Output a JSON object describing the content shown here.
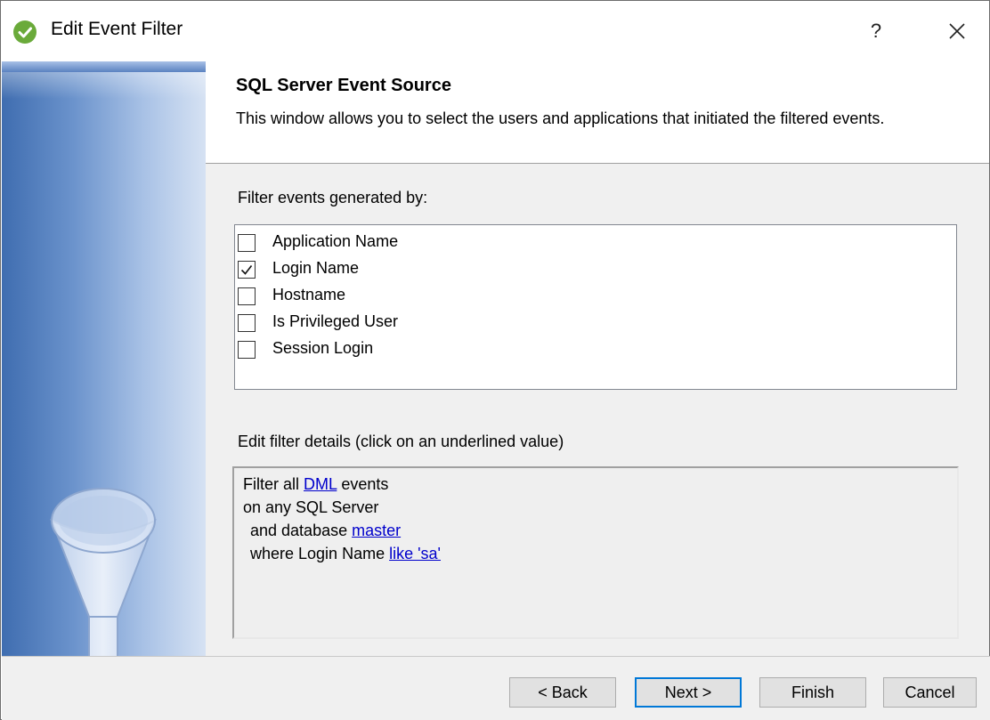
{
  "window": {
    "title": "Edit Event Filter",
    "help_label": "?",
    "colors": {
      "side_panel": "#5a82c0",
      "link": "#0000cc",
      "app_icon": "#6aaa3a"
    }
  },
  "header": {
    "title": "SQL Server Event Source",
    "description": "This window allows you to select the users and applications that initiated the filtered events."
  },
  "filter_section": {
    "label": "Filter events generated by:",
    "items": [
      {
        "label": "Application Name",
        "checked": false
      },
      {
        "label": "Login Name",
        "checked": true
      },
      {
        "label": "Hostname",
        "checked": false
      },
      {
        "label": "Is Privileged User",
        "checked": false
      },
      {
        "label": "Session Login",
        "checked": false
      }
    ]
  },
  "details_section": {
    "label": "Edit filter details (click on an underlined value)",
    "lines": [
      {
        "prefix": "Filter all ",
        "link": "DML",
        "suffix": " events"
      },
      {
        "prefix": "on any SQL Server",
        "link": "",
        "suffix": ""
      },
      {
        "prefix": "  and database ",
        "link": "master",
        "suffix": ""
      },
      {
        "prefix": "  where Login Name ",
        "link": "like 'sa'",
        "suffix": ""
      }
    ]
  },
  "buttons": {
    "back": "< Back",
    "next": "Next >",
    "finish": "Finish",
    "cancel": "Cancel"
  },
  "icons": {
    "app": "check-circle-icon",
    "close": "close-icon",
    "side": "funnel-icon"
  }
}
